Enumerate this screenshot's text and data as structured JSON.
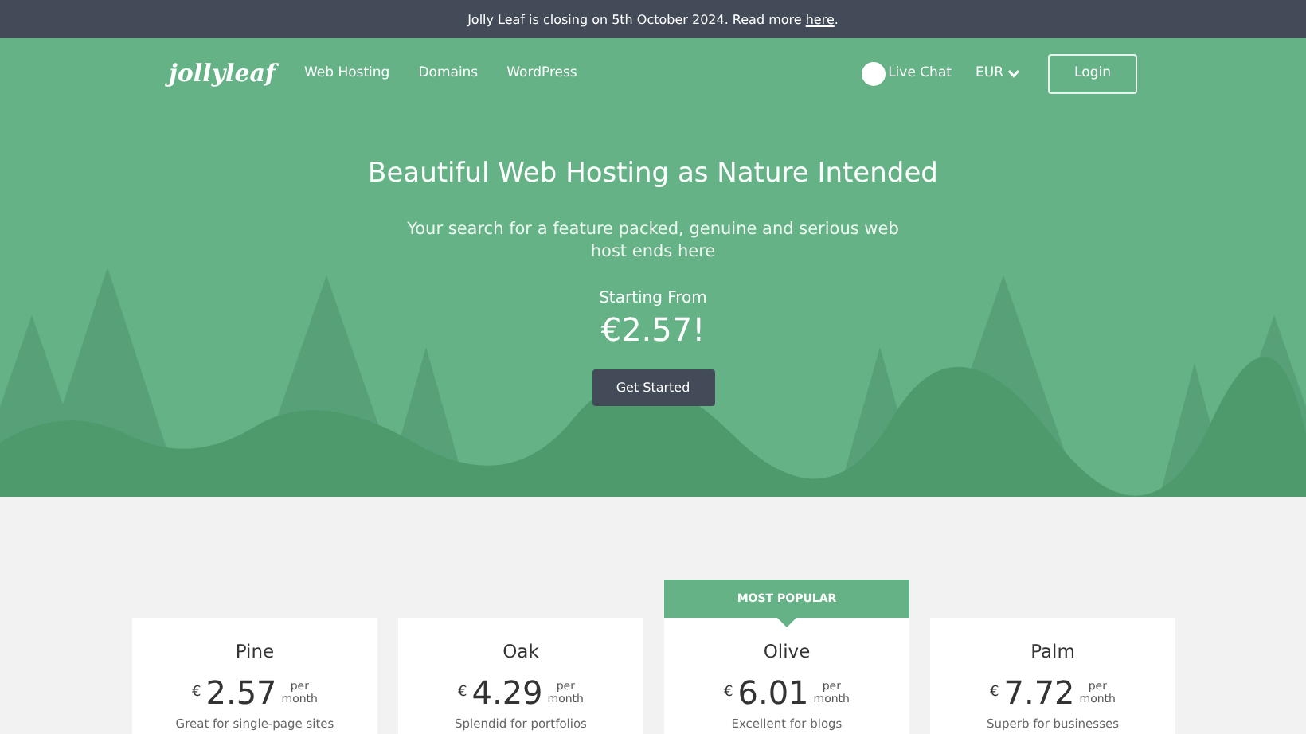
{
  "banner": {
    "text": "Jolly Leaf is closing on 5th October 2024. Read more ",
    "link": "here",
    "end": "."
  },
  "header": {
    "logo": "jollyleaf",
    "nav": [
      "Web Hosting",
      "Domains",
      "WordPress"
    ],
    "live_chat": "Live Chat",
    "currency": "EUR",
    "login": "Login"
  },
  "hero": {
    "title": "Beautiful Web Hosting as Nature Intended",
    "subtitle": "Your search for a feature packed, genuine and serious web host ends here",
    "starting_label": "Starting From",
    "starting_price": "€2.57!",
    "cta": "Get Started"
  },
  "plans": [
    {
      "name": "Pine",
      "currency": "€",
      "price": "2.57",
      "per": "per",
      "period": "month",
      "description": "Great for single-page sites",
      "popular": false
    },
    {
      "name": "Oak",
      "currency": "€",
      "price": "4.29",
      "per": "per",
      "period": "month",
      "description": "Splendid for portfolios",
      "popular": false
    },
    {
      "name": "Olive",
      "currency": "€",
      "price": "6.01",
      "per": "per",
      "period": "month",
      "description": "Excellent for blogs",
      "popular": true,
      "badge": "MOST POPULAR"
    },
    {
      "name": "Palm",
      "currency": "€",
      "price": "7.72",
      "per": "per",
      "period": "month",
      "description": "Superb for businesses",
      "popular": false
    }
  ]
}
